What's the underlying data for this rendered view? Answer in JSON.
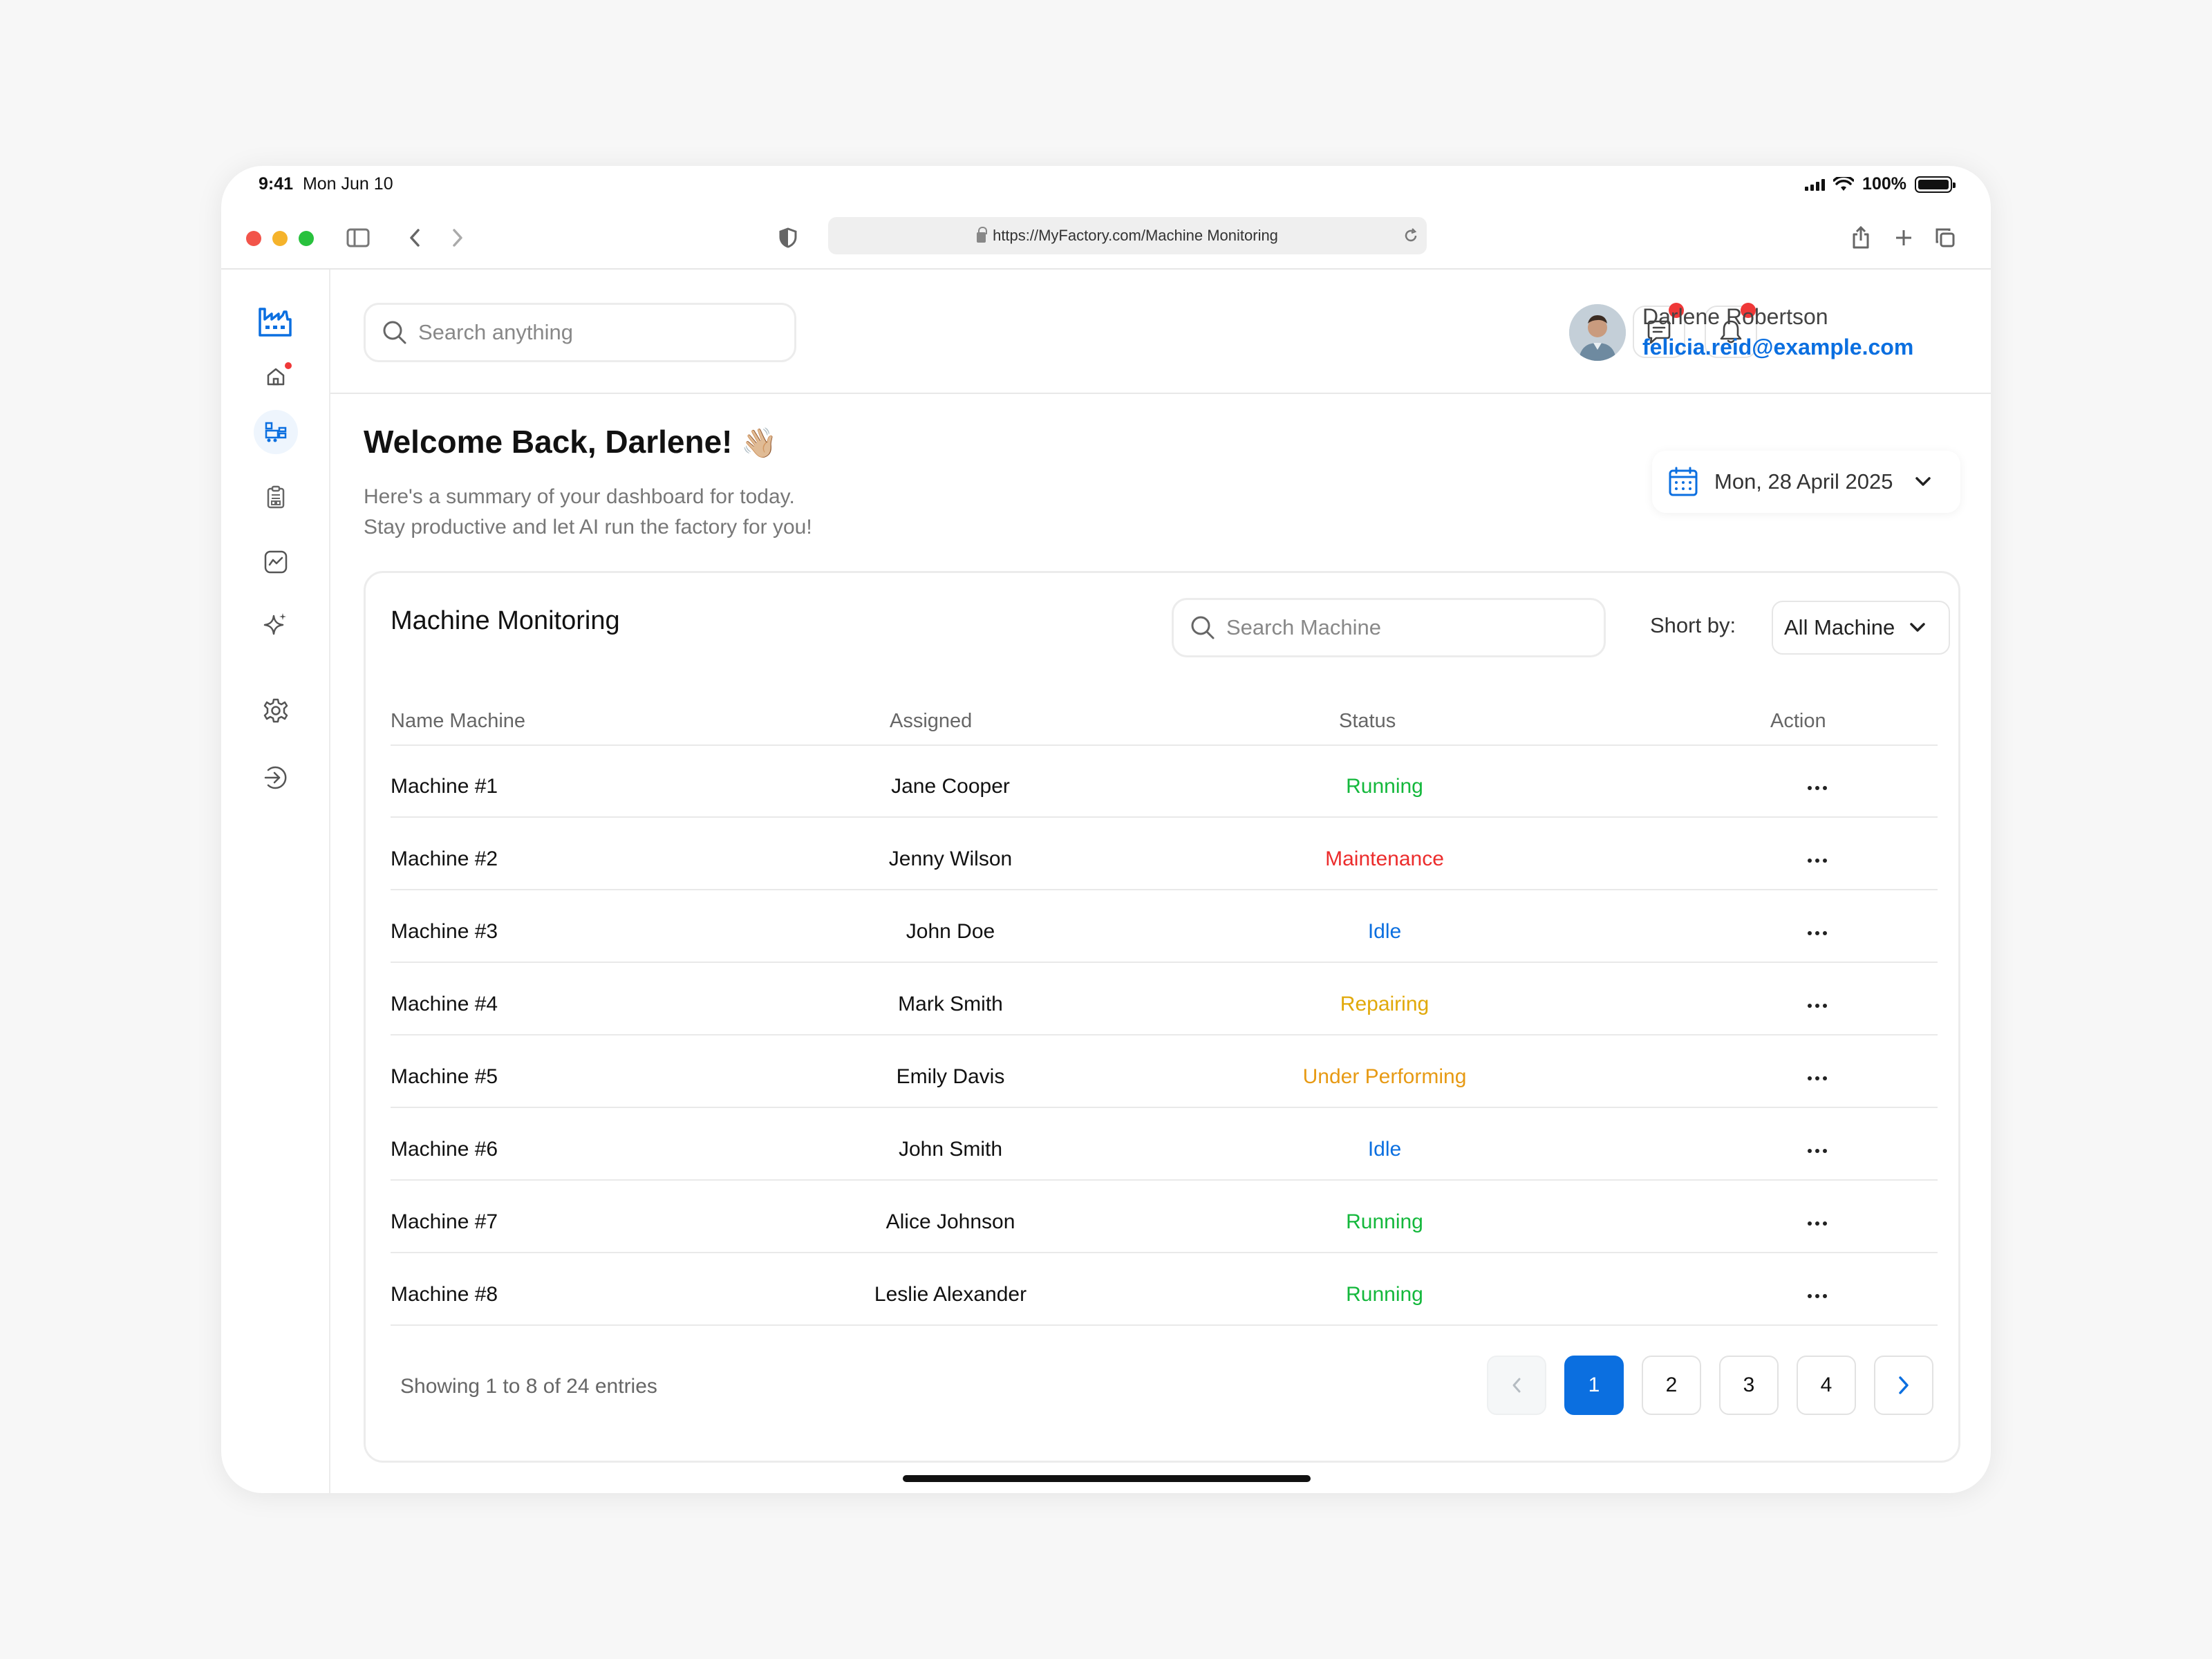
{
  "status_bar": {
    "time": "9:41",
    "date": "Mon Jun 10",
    "battery": "100%"
  },
  "browser": {
    "url": "https://MyFactory.com/Machine Monitoring"
  },
  "header": {
    "search_placeholder": "Search anything",
    "user_name": "Darlene Robertson",
    "user_email": "felicia.reid@example.com"
  },
  "welcome": {
    "title": "Welcome Back, Darlene!",
    "emoji": "👋🏼",
    "line1": "Here's a summary of your dashboard for today.",
    "line2": "Stay productive and let AI run the factory for you!",
    "date": "Mon, 28 April 2025"
  },
  "monitoring": {
    "title": "Machine Monitoring",
    "search_placeholder": "Search Machine",
    "sort_label": "Short by:",
    "sort_value": "All Machine",
    "columns": [
      "Name Machine",
      "Assigned",
      "Status",
      "Action"
    ],
    "rows": [
      {
        "name": "Machine #1",
        "assigned": "Jane Cooper",
        "status": "Running"
      },
      {
        "name": "Machine #2",
        "assigned": "Jenny Wilson",
        "status": "Maintenance"
      },
      {
        "name": "Machine #3",
        "assigned": "John Doe",
        "status": "Idle"
      },
      {
        "name": "Machine #4",
        "assigned": "Mark Smith",
        "status": "Repairing"
      },
      {
        "name": "Machine #5",
        "assigned": "Emily Davis",
        "status": "Under Performing"
      },
      {
        "name": "Machine #6",
        "assigned": "John Smith",
        "status": "Idle"
      },
      {
        "name": "Machine #7",
        "assigned": "Alice Johnson",
        "status": "Running"
      },
      {
        "name": "Machine #8",
        "assigned": "Leslie Alexander",
        "status": "Running"
      }
    ],
    "status_colors": {
      "Running": "#14b83c",
      "Maintenance": "#ec2c2c",
      "Idle": "#0b6fe0",
      "Repairing": "#e1a90a",
      "Under Performing": "#e79a14"
    },
    "showing": "Showing 1 to 8 of 24 entries",
    "pages": [
      "1",
      "2",
      "3",
      "4"
    ],
    "active_page": "1"
  },
  "colors": {
    "accent": "#0b6fe0",
    "badge": "#ef3838"
  },
  "sidebar_icons": [
    "factory-logo-icon",
    "home-icon",
    "machine-icon",
    "clipboard-icon",
    "analytics-icon",
    "ai-sparkle-icon",
    "settings-icon",
    "logout-icon"
  ]
}
